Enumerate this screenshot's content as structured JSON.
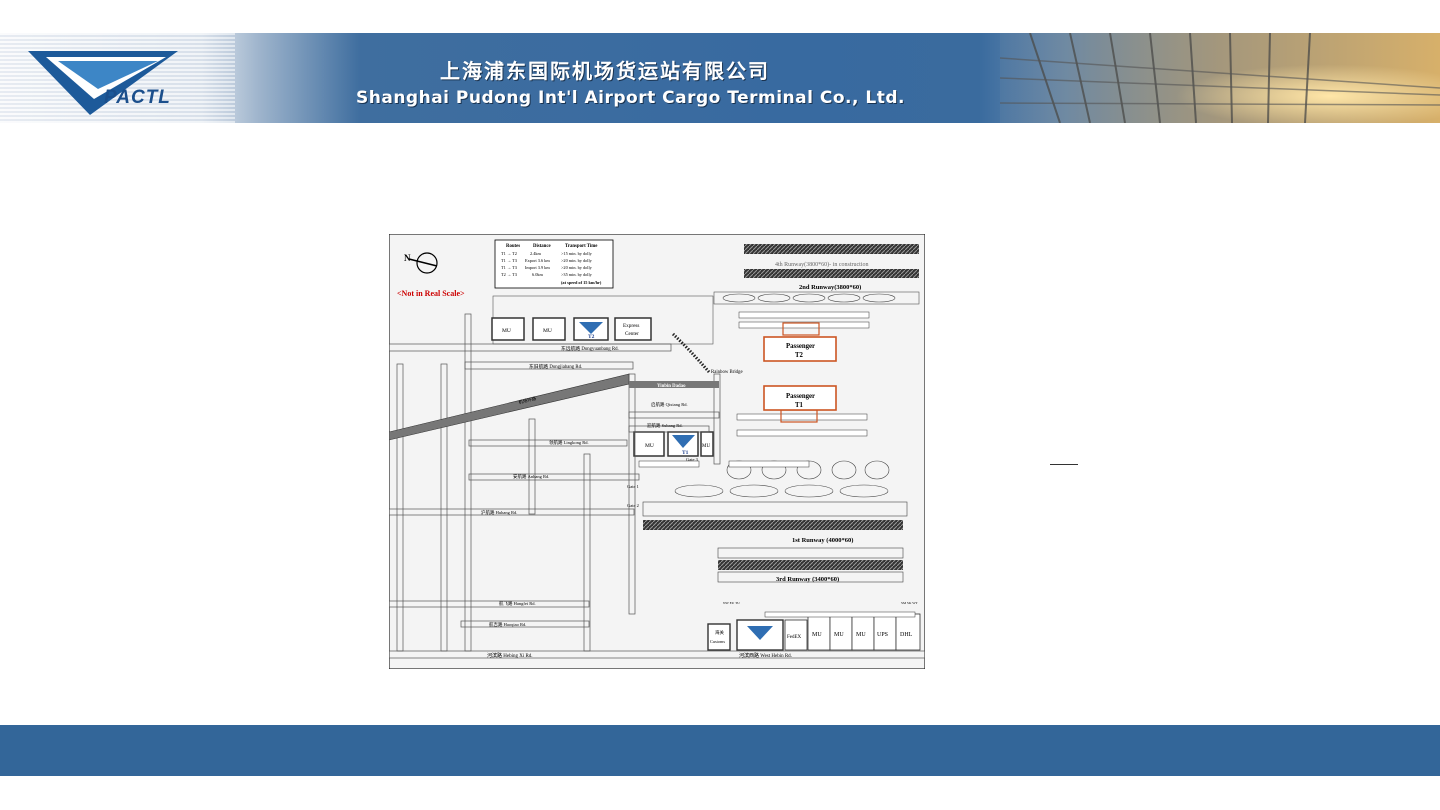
{
  "header": {
    "logo_text": "PACTL",
    "company_cn": "上海浦东国际机场货运站有限公司",
    "company_en": "Shanghai Pudong Int'l Airport Cargo Terminal Co., Ltd."
  },
  "map": {
    "scale_note": "<Not in Real Scale>",
    "transport_table": {
      "headers": [
        "Routes",
        "Distance",
        "Transport Time"
      ],
      "rows": [
        [
          "T1 → T2",
          "2.4km",
          ">15 min. by dolly"
        ],
        [
          "T1 → T3",
          "Export 3.6 km",
          ">20 min. by dolly"
        ],
        [
          "T1 → T3",
          "Import 3.9 km",
          ">20 min. by dolly"
        ],
        [
          "T2 → T3",
          "6.0km",
          ">35 min. by dolly"
        ]
      ],
      "footnote": "(at speed of 15 km/hr)"
    },
    "runways": {
      "r4": "4th Runway(3800*60)- in construction",
      "r2": "2nd Runway(3800*60)",
      "r1": "1st Runway (4000*60)",
      "r3": "3rd Runway (3400*60)"
    },
    "passenger_t2": [
      "Passenger",
      "T2"
    ],
    "passenger_t1": [
      "Passenger",
      "T1"
    ],
    "t2_buildings": [
      "MU",
      "MU",
      "Express",
      "Center"
    ],
    "t2_label": "T2",
    "t1_buildings": [
      "MU",
      "MU"
    ],
    "t1_label": "T1",
    "t1_gates": [
      "Gate 1",
      "Gate 2",
      "Gate 3"
    ],
    "roads": {
      "dongyuanbang": "东远航路  Dongyuanbang Rd.",
      "dongjiabang": "东旧航路  Dongjiabang Rd.",
      "yinbin": "Yinbin Dadao",
      "qixiang": "启航路  Qixiang Rd.",
      "subang": "迎航路  Subang Rd.",
      "lingkong": "领航路  Lingkong Rd.",
      "anhang": "安航路  Anhang Rd.",
      "huhang": "沪航路  Huhang Rd.",
      "haogfei": "航飞路  Hangfei Rd.",
      "hanqiao": "航吉路  Haoqiao Rd.",
      "hebing": "河滨路  Hebing Xi Rd.",
      "west_hebin": "河滨西路  West Hebin Rd.",
      "rainbow_bridge": "Rainbow Bridge",
      "airport_ring": "机场环路"
    },
    "cargo_area": [
      "Customs",
      "FedEX",
      "MU",
      "MU",
      "MU",
      "UPS",
      "DHL"
    ],
    "customs_cn": "海关",
    "cargo_tags": [
      "NW EU TU",
      "SM SK WT"
    ]
  },
  "colors": {
    "banner_blue": "#386aa0",
    "footer_blue": "#336699",
    "passenger_red": "#cc5522"
  }
}
